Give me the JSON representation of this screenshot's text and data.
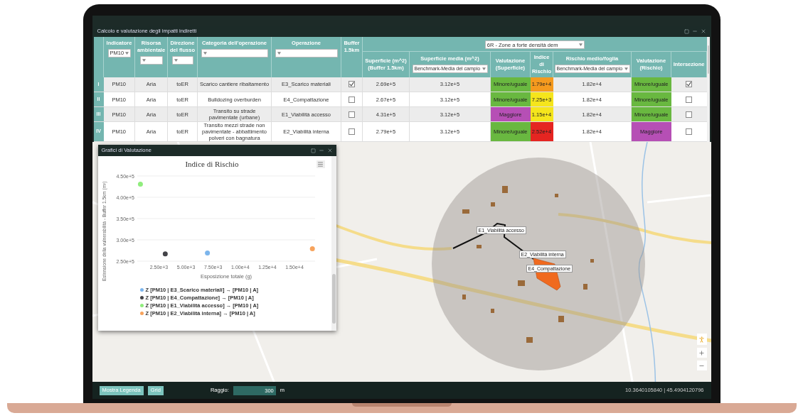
{
  "table_window": {
    "title": "Calcolo e valutazione degli impatti indiretti"
  },
  "table": {
    "columns": [
      {
        "label": "Indicatore",
        "kind": "select",
        "value": "PM10"
      },
      {
        "label": "Risorsa ambientale",
        "kind": "select"
      },
      {
        "label": "Direzione del flusso",
        "kind": "select"
      },
      {
        "label": "Categoria dell'operazione",
        "kind": "select"
      },
      {
        "label": "Operazione",
        "kind": "select"
      },
      {
        "label": "Buffer 1.5km",
        "kind": "plain"
      }
    ],
    "group": {
      "filter": "6R - Zone a forte densità dem"
    },
    "group_columns": [
      {
        "label": "Superficie (m^2) (Buffer 1.5km)",
        "kind": "plain"
      },
      {
        "label": "Superficie media (m^2)",
        "kind": "select",
        "value": "Benchmark-Media del campio"
      },
      {
        "label": "Valutazione (Superficie)",
        "kind": "plain"
      },
      {
        "label": "Indice di Rischio",
        "kind": "plain"
      },
      {
        "label": "Rischio medio/foglia",
        "kind": "select",
        "value": "Benchmark-Media del campio"
      },
      {
        "label": "Valutazione (Rischio)",
        "kind": "plain"
      },
      {
        "label": "Intersezione",
        "kind": "plain"
      }
    ],
    "rows": [
      {
        "header": "I",
        "indicatore": "PM10",
        "risorsa": "Aria",
        "direzione": "toER",
        "categoria": "Scarico cantiere ribaltamento",
        "operazione": "E3_Scarico materiali",
        "buffer": true,
        "superficie": "2.69e+5",
        "superficie_media": "3.12e+5",
        "valutazione_superficie": {
          "text": "Minore/uguale",
          "color": "#69b840"
        },
        "indice": {
          "text": "1.79e+4",
          "color": "#f59a1e"
        },
        "rischio_medio": "1.82e+4",
        "valutazione_rischio": {
          "text": "Minore/uguale",
          "color": "#69b840"
        },
        "intersezione": true
      },
      {
        "header": "II",
        "indicatore": "PM10",
        "risorsa": "Aria",
        "direzione": "toER",
        "categoria": "Bulldozing overburden",
        "operazione": "E4_Compattazione",
        "buffer": false,
        "superficie": "2.67e+5",
        "superficie_media": "3.12e+5",
        "valutazione_superficie": {
          "text": "Minore/uguale",
          "color": "#69b840"
        },
        "indice": {
          "text": "7.25e+3",
          "color": "#f5e51c"
        },
        "rischio_medio": "1.82e+4",
        "valutazione_rischio": {
          "text": "Minore/uguale",
          "color": "#69b840"
        },
        "intersezione": false
      },
      {
        "header": "III",
        "indicatore": "PM10",
        "risorsa": "Aria",
        "direzione": "toER",
        "categoria": "Transito su strade pavimentate (urbane)",
        "operazione": "E1_Viabilità accesso",
        "buffer": false,
        "superficie": "4.31e+5",
        "superficie_media": "3.12e+5",
        "valutazione_superficie": {
          "text": "Maggiore",
          "color": "#b64fb5"
        },
        "indice": {
          "text": "1.15e+4",
          "color": "#f5e51c"
        },
        "rischio_medio": "1.82e+4",
        "valutazione_rischio": {
          "text": "Minore/uguale",
          "color": "#69b840"
        },
        "intersezione": false
      },
      {
        "header": "IV",
        "indicatore": "PM10",
        "risorsa": "Aria",
        "direzione": "toER",
        "categoria": "Transito mezzi strade non pavimentate - abbattimento polveri con bagnatura",
        "operazione": "E2_Viabilità interna",
        "buffer": false,
        "superficie": "2.79e+5",
        "superficie_media": "3.12e+5",
        "valutazione_superficie": {
          "text": "Minore/uguale",
          "color": "#69b840"
        },
        "indice": {
          "text": "2.52e+4",
          "color": "#e52521"
        },
        "rischio_medio": "1.82e+4",
        "valutazione_rischio": {
          "text": "Maggiore",
          "color": "#b64fb5"
        },
        "intersezione": false
      }
    ]
  },
  "chart_window": {
    "title": "Grafici di Valutazione"
  },
  "chart": {
    "chart_data": {
      "type": "scatter",
      "title": "Indice di Rischio",
      "xlabel": "Esposizione totale (g)",
      "ylabel": "Estensione della vulnerabilità - Buffer 1.5km (m²)",
      "xlim": [
        500,
        16900
      ],
      "ylim": [
        250000,
        450000
      ],
      "xticks": [
        {
          "value": 2500,
          "label": "2.50e+3"
        },
        {
          "value": 5000,
          "label": "5.00e+3"
        },
        {
          "value": 7500,
          "label": "7.50e+3"
        },
        {
          "value": 10000,
          "label": "1.00e+4"
        },
        {
          "value": 12500,
          "label": "1.25e+4"
        },
        {
          "value": 15000,
          "label": "1.50e+4"
        }
      ],
      "yticks": [
        {
          "value": 250000,
          "label": "2.50e+5"
        },
        {
          "value": 300000,
          "label": "3.00e+5"
        },
        {
          "value": 350000,
          "label": "3.50e+5"
        },
        {
          "value": 400000,
          "label": "4.00e+5"
        },
        {
          "value": 450000,
          "label": "4.50e+5"
        }
      ],
      "grid": true,
      "x": [
        790,
        3080,
        6970,
        16650
      ],
      "series": [
        {
          "name": "Z [PM10 | E3_Scarico materiali] → [PM10 | A]",
          "color": "#7cb5ec",
          "values": [
            null,
            null,
            269000,
            null
          ]
        },
        {
          "name": "Z [PM10 | E4_Compattazione] → [PM10 | A]",
          "color": "#434348",
          "values": [
            null,
            267000,
            null,
            null
          ]
        },
        {
          "name": "Z [PM10 | E1_Viabilità accesso] → [PM10 | A]",
          "color": "#90ed7d",
          "values": [
            431000,
            null,
            null,
            null
          ]
        },
        {
          "name": "Z [PM10 | E2_Viabilità interna] → [PM10 | A]",
          "color": "#f7a35c",
          "values": [
            null,
            null,
            null,
            279000
          ]
        }
      ]
    }
  },
  "map": {
    "overlays": [
      {
        "label": "E1_Viabilità accesso"
      },
      {
        "label": "E2_Viabilità interna"
      },
      {
        "label": "E4_Compattazione"
      }
    ]
  },
  "bottom_bar": {
    "buttons": [
      "Mostra Legenda",
      "Grid"
    ],
    "radius": {
      "label": "Raggio:",
      "value": "300",
      "unit": "m"
    },
    "coordinates": "10.3640105840 | 45.4904120796"
  }
}
